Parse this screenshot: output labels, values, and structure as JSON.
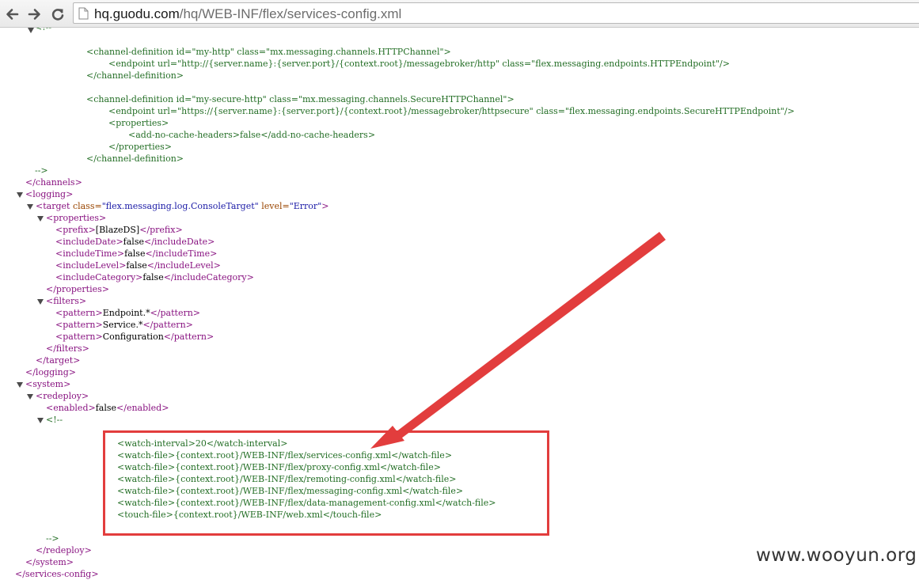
{
  "browser": {
    "url_host": "hq.guodu.com",
    "url_path": "/hq/WEB-INF/flex/services-config.xml",
    "icons": [
      "back-arrow-icon",
      "forward-arrow-icon",
      "reload-icon",
      "page-icon"
    ]
  },
  "xml_lines": [
    {
      "text": "<!--",
      "cls": "cmt"
    },
    {
      "text": "<channel-definition id=\"my-http\" class=\"mx.messaging.channels.HTTPChannel\">",
      "cls": "cmt"
    },
    {
      "text": "<endpoint url=\"http://{server.name}:{server.port}/{context.root}/messagebroker/http\" class=\"flex.messaging.endpoints.HTTPEndpoint\"/>",
      "cls": "cmt"
    },
    {
      "text": "</channel-definition>",
      "cls": "cmt"
    },
    {
      "text": "<channel-definition id=\"my-secure-http\" class=\"mx.messaging.channels.SecureHTTPChannel\">",
      "cls": "cmt"
    },
    {
      "text": "<endpoint url=\"https://{server.name}:{server.port}/{context.root}/messagebroker/httpsecure\" class=\"flex.messaging.endpoints.SecureHTTPEndpoint\"/>",
      "cls": "cmt"
    },
    {
      "text": "<properties>",
      "cls": "cmt"
    },
    {
      "text": "<add-no-cache-headers>false</add-no-cache-headers>",
      "cls": "cmt"
    },
    {
      "text": "</properties>",
      "cls": "cmt"
    },
    {
      "text": "</channel-definition>",
      "cls": "cmt"
    },
    {
      "text": "-->",
      "cls": "cmt"
    },
    {
      "text": "</channels>",
      "cls": "tag"
    },
    {
      "text": "<logging>",
      "cls": "tag"
    },
    {
      "text": "<target",
      "cls": "tag"
    },
    {
      "text": "class=",
      "cls": "attr"
    },
    {
      "text": "\"flex.messaging.log.ConsoleTarget\"",
      "cls": "aval"
    },
    {
      "text": "level=",
      "cls": "attr"
    },
    {
      "text": "\"Error\"",
      "cls": "aval"
    },
    {
      "text": ">",
      "cls": "tag"
    },
    {
      "text": "<properties>",
      "cls": "tag"
    },
    {
      "text": "<prefix>",
      "cls": "tag"
    },
    {
      "text": "[BlazeDS]",
      "cls": "txt"
    },
    {
      "text": "</prefix>",
      "cls": "tag"
    },
    {
      "text": "<includeDate>",
      "cls": "tag"
    },
    {
      "text": "false",
      "cls": "txt"
    },
    {
      "text": "</includeDate>",
      "cls": "tag"
    },
    {
      "text": "<includeTime>",
      "cls": "tag"
    },
    {
      "text": "false",
      "cls": "txt"
    },
    {
      "text": "</includeTime>",
      "cls": "tag"
    },
    {
      "text": "<includeLevel>",
      "cls": "tag"
    },
    {
      "text": "false",
      "cls": "txt"
    },
    {
      "text": "</includeLevel>",
      "cls": "tag"
    },
    {
      "text": "<includeCategory>",
      "cls": "tag"
    },
    {
      "text": "false",
      "cls": "txt"
    },
    {
      "text": "</includeCategory>",
      "cls": "tag"
    },
    {
      "text": "</properties>",
      "cls": "tag"
    },
    {
      "text": "<filters>",
      "cls": "tag"
    },
    {
      "text": "<pattern>",
      "cls": "tag"
    },
    {
      "text": "Endpoint.*",
      "cls": "txt"
    },
    {
      "text": "</pattern>",
      "cls": "tag"
    },
    {
      "text": "<pattern>",
      "cls": "tag"
    },
    {
      "text": "Service.*",
      "cls": "txt"
    },
    {
      "text": "</pattern>",
      "cls": "tag"
    },
    {
      "text": "<pattern>",
      "cls": "tag"
    },
    {
      "text": "Configuration",
      "cls": "txt"
    },
    {
      "text": "</pattern>",
      "cls": "tag"
    },
    {
      "text": "</filters>",
      "cls": "tag"
    },
    {
      "text": "</target>",
      "cls": "tag"
    },
    {
      "text": "</logging>",
      "cls": "tag"
    },
    {
      "text": "<system>",
      "cls": "tag"
    },
    {
      "text": "<redeploy>",
      "cls": "tag"
    },
    {
      "text": "<enabled>",
      "cls": "tag"
    },
    {
      "text": "false",
      "cls": "txt"
    },
    {
      "text": "</enabled>",
      "cls": "tag"
    },
    {
      "text": "<!--",
      "cls": "cmt"
    },
    {
      "text": "<watch-interval>20</watch-interval>",
      "cls": "cmt"
    },
    {
      "text": "<watch-file>{context.root}/WEB-INF/flex/services-config.xml</watch-file>",
      "cls": "cmt"
    },
    {
      "text": "<watch-file>{context.root}/WEB-INF/flex/proxy-config.xml</watch-file>",
      "cls": "cmt"
    },
    {
      "text": "<watch-file>{context.root}/WEB-INF/flex/remoting-config.xml</watch-file>",
      "cls": "cmt"
    },
    {
      "text": "<watch-file>{context.root}/WEB-INF/flex/messaging-config.xml</watch-file>",
      "cls": "cmt"
    },
    {
      "text": "<watch-file>{context.root}/WEB-INF/flex/data-management-config.xml</watch-file>",
      "cls": "cmt"
    },
    {
      "text": "<touch-file>{context.root}/WEB-INF/web.xml</touch-file>",
      "cls": "cmt"
    },
    {
      "text": "-->",
      "cls": "cmt"
    },
    {
      "text": "</redeploy>",
      "cls": "tag"
    },
    {
      "text": "</system>",
      "cls": "tag"
    },
    {
      "text": "</services-config>",
      "cls": "tag"
    }
  ],
  "annotation": {
    "color": "#e23d3d"
  },
  "watermark": "www.wooyun.org"
}
